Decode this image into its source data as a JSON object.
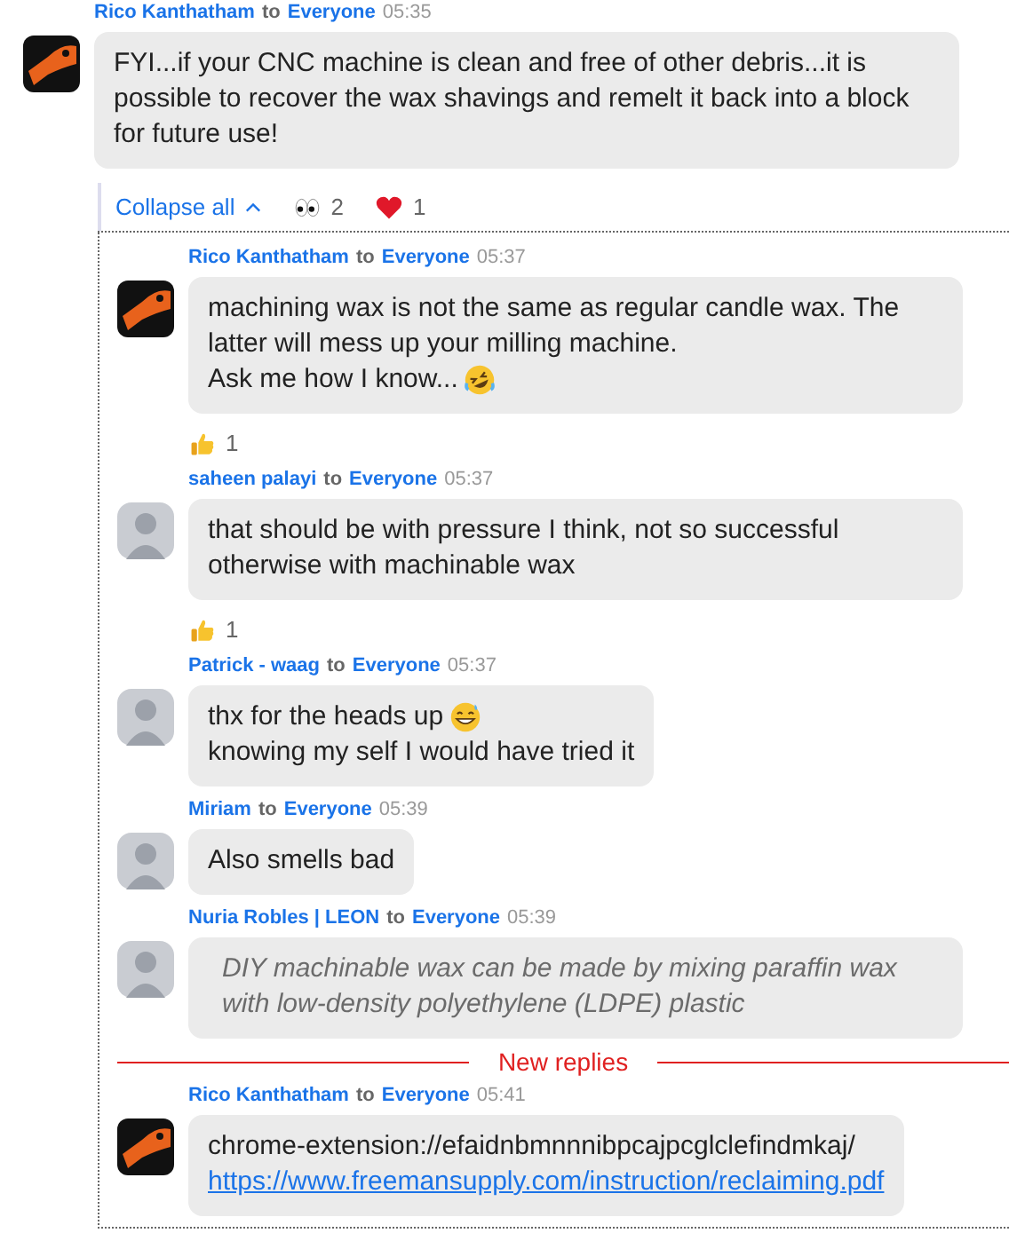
{
  "top_message": {
    "author": "Rico Kanthatham",
    "to": "to",
    "recipient": "Everyone",
    "time": "05:35",
    "avatar": {
      "kind": "logo"
    },
    "lines": [
      {
        "kind": "plain",
        "text": "FYI...if your CNC machine is clean and free of other debris...it is possible to recover the wax shavings and remelt it back into a block for future use!"
      }
    ]
  },
  "thread_bar": {
    "collapse": "Collapse all",
    "reactions": [
      {
        "kind": "eyes",
        "count": "2"
      },
      {
        "kind": "heart",
        "count": "1"
      }
    ]
  },
  "thread": [
    {
      "kind": "message",
      "author": "Rico Kanthatham",
      "to": "to",
      "recipient": "Everyone",
      "time": "05:37",
      "avatar": {
        "kind": "logo"
      },
      "lines": [
        {
          "kind": "plain",
          "text": "machining wax is not the same as regular candle wax. The latter will mess up your milling machine."
        },
        {
          "kind": "plain",
          "text": "Ask me how I know...",
          "emoji": {
            "kind": "rofl"
          }
        }
      ],
      "reactions": [
        {
          "kind": "thumbs-up",
          "count": "1"
        }
      ]
    },
    {
      "kind": "message",
      "author": "saheen palayi",
      "to": "to",
      "recipient": "Everyone",
      "time": "05:37",
      "avatar": {
        "kind": "photo"
      },
      "lines": [
        {
          "kind": "plain",
          "text": "that should be with pressure I think, not so successful otherwise with machinable wax"
        }
      ],
      "reactions": [
        {
          "kind": "thumbs-up",
          "count": "1"
        }
      ]
    },
    {
      "kind": "message",
      "author": "Patrick - waag",
      "to": "to",
      "recipient": "Everyone",
      "time": "05:37",
      "avatar": {
        "kind": "photo"
      },
      "lines": [
        {
          "kind": "plain",
          "text": "thx for the heads up",
          "emoji": {
            "kind": "sweat-smile"
          }
        },
        {
          "kind": "plain",
          "text": "knowing my self I would have tried it"
        }
      ]
    },
    {
      "kind": "message",
      "author": "Miriam",
      "to": "to",
      "recipient": "Everyone",
      "time": "05:39",
      "avatar": {
        "kind": "photo"
      },
      "lines": [
        {
          "kind": "plain",
          "text": "Also smells bad"
        }
      ]
    },
    {
      "kind": "message",
      "author": "Nuria Robles | LEON",
      "to": "to",
      "recipient": "Everyone",
      "time": "05:39",
      "avatar": {
        "kind": "photo"
      },
      "lines": [
        {
          "kind": "italic",
          "text": "DIY machinable wax can be made by mixing paraffin wax with low-density polyethylene (LDPE) plastic"
        }
      ]
    },
    {
      "kind": "divider",
      "label": "New replies"
    },
    {
      "kind": "message",
      "author": "Rico Kanthatham",
      "to": "to",
      "recipient": "Everyone",
      "time": "05:41",
      "avatar": {
        "kind": "logo"
      },
      "lines": [
        {
          "kind": "plain",
          "text": "chrome-extension://efaidnbmnnnibpcajpcglclefindmkaj/"
        },
        {
          "kind": "link",
          "text": "https://www.freemansupply.com/instruction/reclaiming.pdf"
        }
      ]
    }
  ]
}
